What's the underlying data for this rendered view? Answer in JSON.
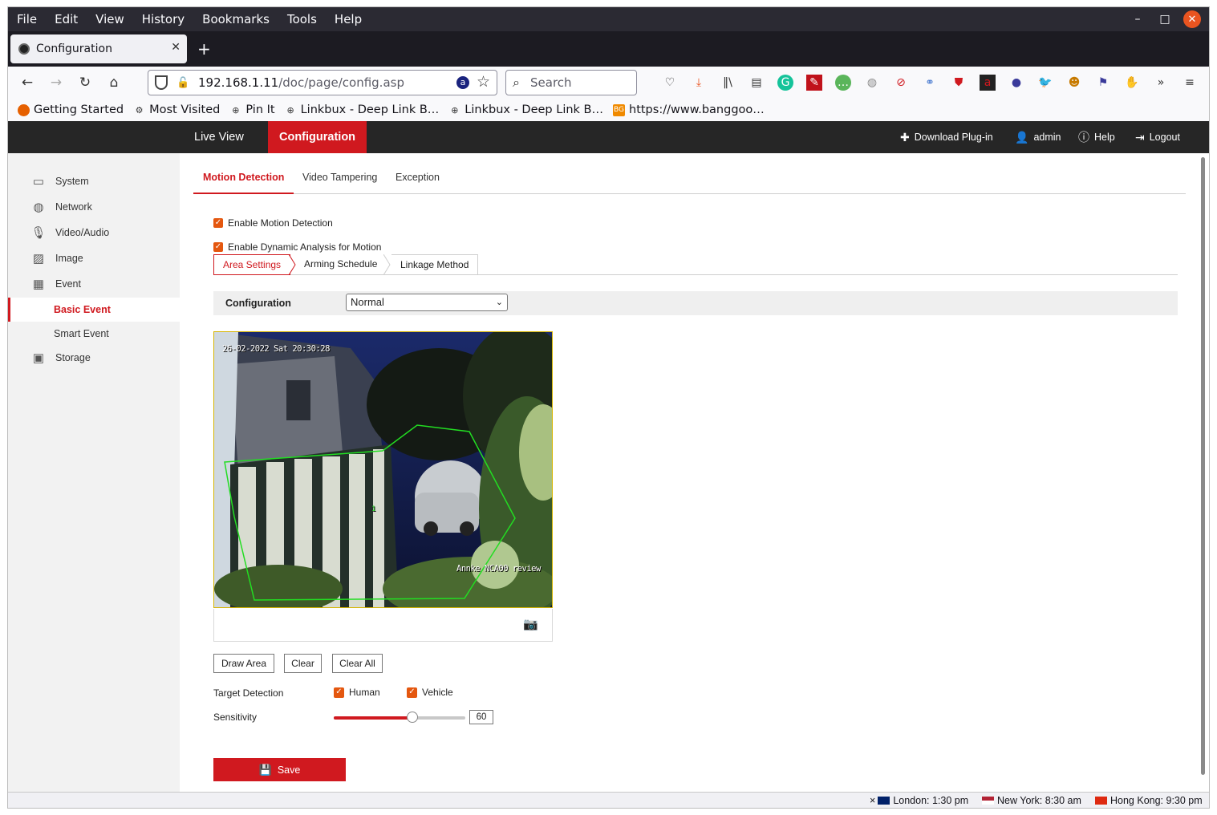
{
  "browser": {
    "menu": [
      "File",
      "Edit",
      "View",
      "History",
      "Bookmarks",
      "Tools",
      "Help"
    ],
    "window_controls": {
      "minimize": "–",
      "maximize": "□",
      "close": "✕"
    },
    "tab": {
      "title": "Configuration",
      "close": "✕"
    },
    "new_tab": "+",
    "url": {
      "host": "192.168.1.11",
      "path": "/doc/page/config.asp"
    },
    "search_placeholder": "Search",
    "bookmarks": [
      "Getting Started",
      "Most Visited",
      "Pin It",
      "Linkbux - Deep Link B…",
      "Linkbux - Deep Link B…",
      "https://www.banggoo…"
    ]
  },
  "app": {
    "nav": {
      "live_view": "Live View",
      "configuration": "Configuration"
    },
    "header_right": {
      "download": "Download Plug-in",
      "user": "admin",
      "help": "Help",
      "logout": "Logout"
    },
    "sidebar": {
      "system": "System",
      "network": "Network",
      "video_audio": "Video/Audio",
      "image": "Image",
      "event": "Event",
      "basic_event": "Basic Event",
      "smart_event": "Smart Event",
      "storage": "Storage"
    },
    "tabs": [
      "Motion Detection",
      "Video Tampering",
      "Exception"
    ],
    "enable_motion": "Enable Motion Detection",
    "enable_dynamic": "Enable Dynamic Analysis for Motion",
    "subtabs": [
      "Area Settings",
      "Arming Schedule",
      "Linkage Method"
    ],
    "configuration_label": "Configuration",
    "configuration_value": "Normal",
    "video": {
      "timestamp": "26-02-2022 Sat 20:30:28",
      "watermark": "Annke NCA00 review",
      "area_number": "1"
    },
    "buttons": {
      "draw_area": "Draw Area",
      "clear": "Clear",
      "clear_all": "Clear All",
      "save": "Save"
    },
    "target_detection": {
      "label": "Target Detection",
      "human": "Human",
      "vehicle": "Vehicle"
    },
    "sensitivity": {
      "label": "Sensitivity",
      "value": "60",
      "level": 0.6
    }
  },
  "status_bar": {
    "close": "×",
    "london": "London: 1:30 pm",
    "new_york": "New York: 8:30 am",
    "hong_kong": "Hong Kong: 9:30 pm"
  },
  "colors": {
    "accent": "#d0191f",
    "checkbox": "#e4570f",
    "header_bg": "#262626",
    "motion_area": "#22dd22"
  }
}
